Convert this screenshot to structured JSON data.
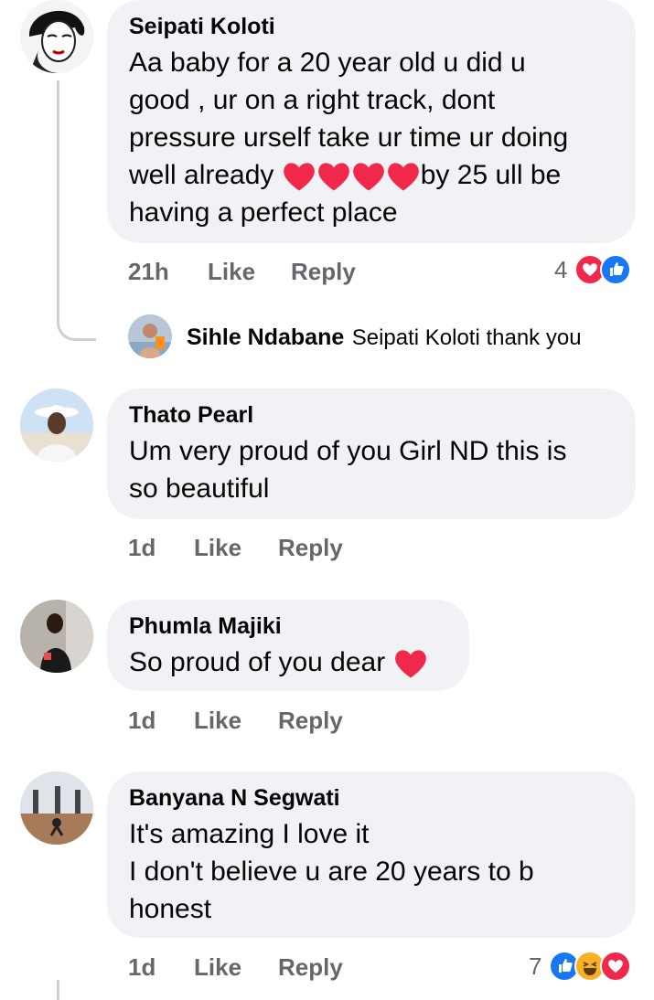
{
  "comments": [
    {
      "author": "Seipati Koloti",
      "text_before": "Aa baby for a 20 year old u did u\ngood , ur on a right track, dont\npressure urself take ur time ur doing\nwell already ",
      "text_after": "by 25 ull be\nhaving a perfect place",
      "hearts": 4,
      "time": "21h",
      "like": "Like",
      "reply": "Reply",
      "reaction_count": "4",
      "reaction_icons": [
        "love-icon",
        "like-icon"
      ]
    },
    {
      "author": "Thato Pearl",
      "text": "Um very proud of you Girl ND this is\nso beautiful",
      "time": "1d",
      "like": "Like",
      "reply": "Reply"
    },
    {
      "author": "Phumla Majiki",
      "text": "So proud of you dear ",
      "hearts": 1,
      "time": "1d",
      "like": "Like",
      "reply": "Reply"
    },
    {
      "author": "Banyana N Segwati",
      "text": "It's amazing I love it\nI don't believe u are 20 years to b\nhonest",
      "time": "1d",
      "like": "Like",
      "reply": "Reply",
      "reaction_count": "7",
      "reaction_icons": [
        "like-icon",
        "haha-icon",
        "love-icon"
      ]
    }
  ],
  "reply": {
    "author": "Sihle Ndabane",
    "text": "Seipati Koloti thank you"
  },
  "colors": {
    "bubble": "#f0f2f5",
    "meta": "#65676b",
    "heart": "#f02849",
    "like_blue": "#1877f2",
    "haha_yellow": "#f7b125",
    "thread_line": "#ced0d4"
  }
}
